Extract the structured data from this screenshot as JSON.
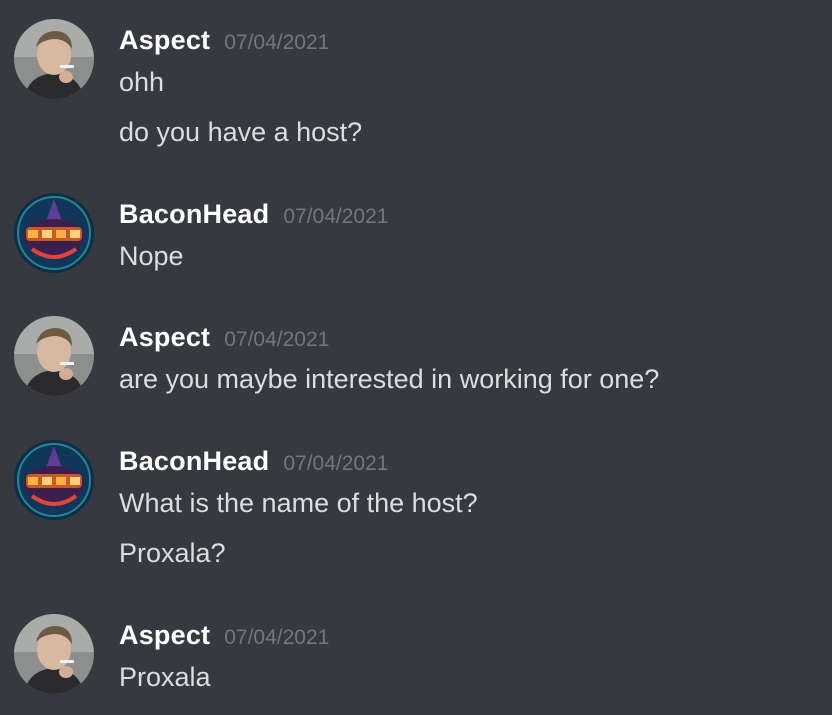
{
  "messages": [
    {
      "author": "Aspect",
      "avatar": "aspect-avatar",
      "timestamp": "07/04/2021",
      "lines": [
        "ohh",
        "do you have a host?"
      ]
    },
    {
      "author": "BaconHead",
      "avatar": "baconhead-avatar",
      "timestamp": "07/04/2021",
      "lines": [
        "Nope"
      ]
    },
    {
      "author": "Aspect",
      "avatar": "aspect-avatar",
      "timestamp": "07/04/2021",
      "lines": [
        "are you maybe interested in working for one?"
      ]
    },
    {
      "author": "BaconHead",
      "avatar": "baconhead-avatar",
      "timestamp": "07/04/2021",
      "lines": [
        "What is the name of the host?",
        "Proxala?"
      ]
    },
    {
      "author": "Aspect",
      "avatar": "aspect-avatar",
      "timestamp": "07/04/2021",
      "lines": [
        "Proxala"
      ]
    }
  ],
  "colors": {
    "background": "#36393f",
    "username": "#ffffff",
    "timestamp": "#72767d",
    "message_text": "#dcddde"
  }
}
